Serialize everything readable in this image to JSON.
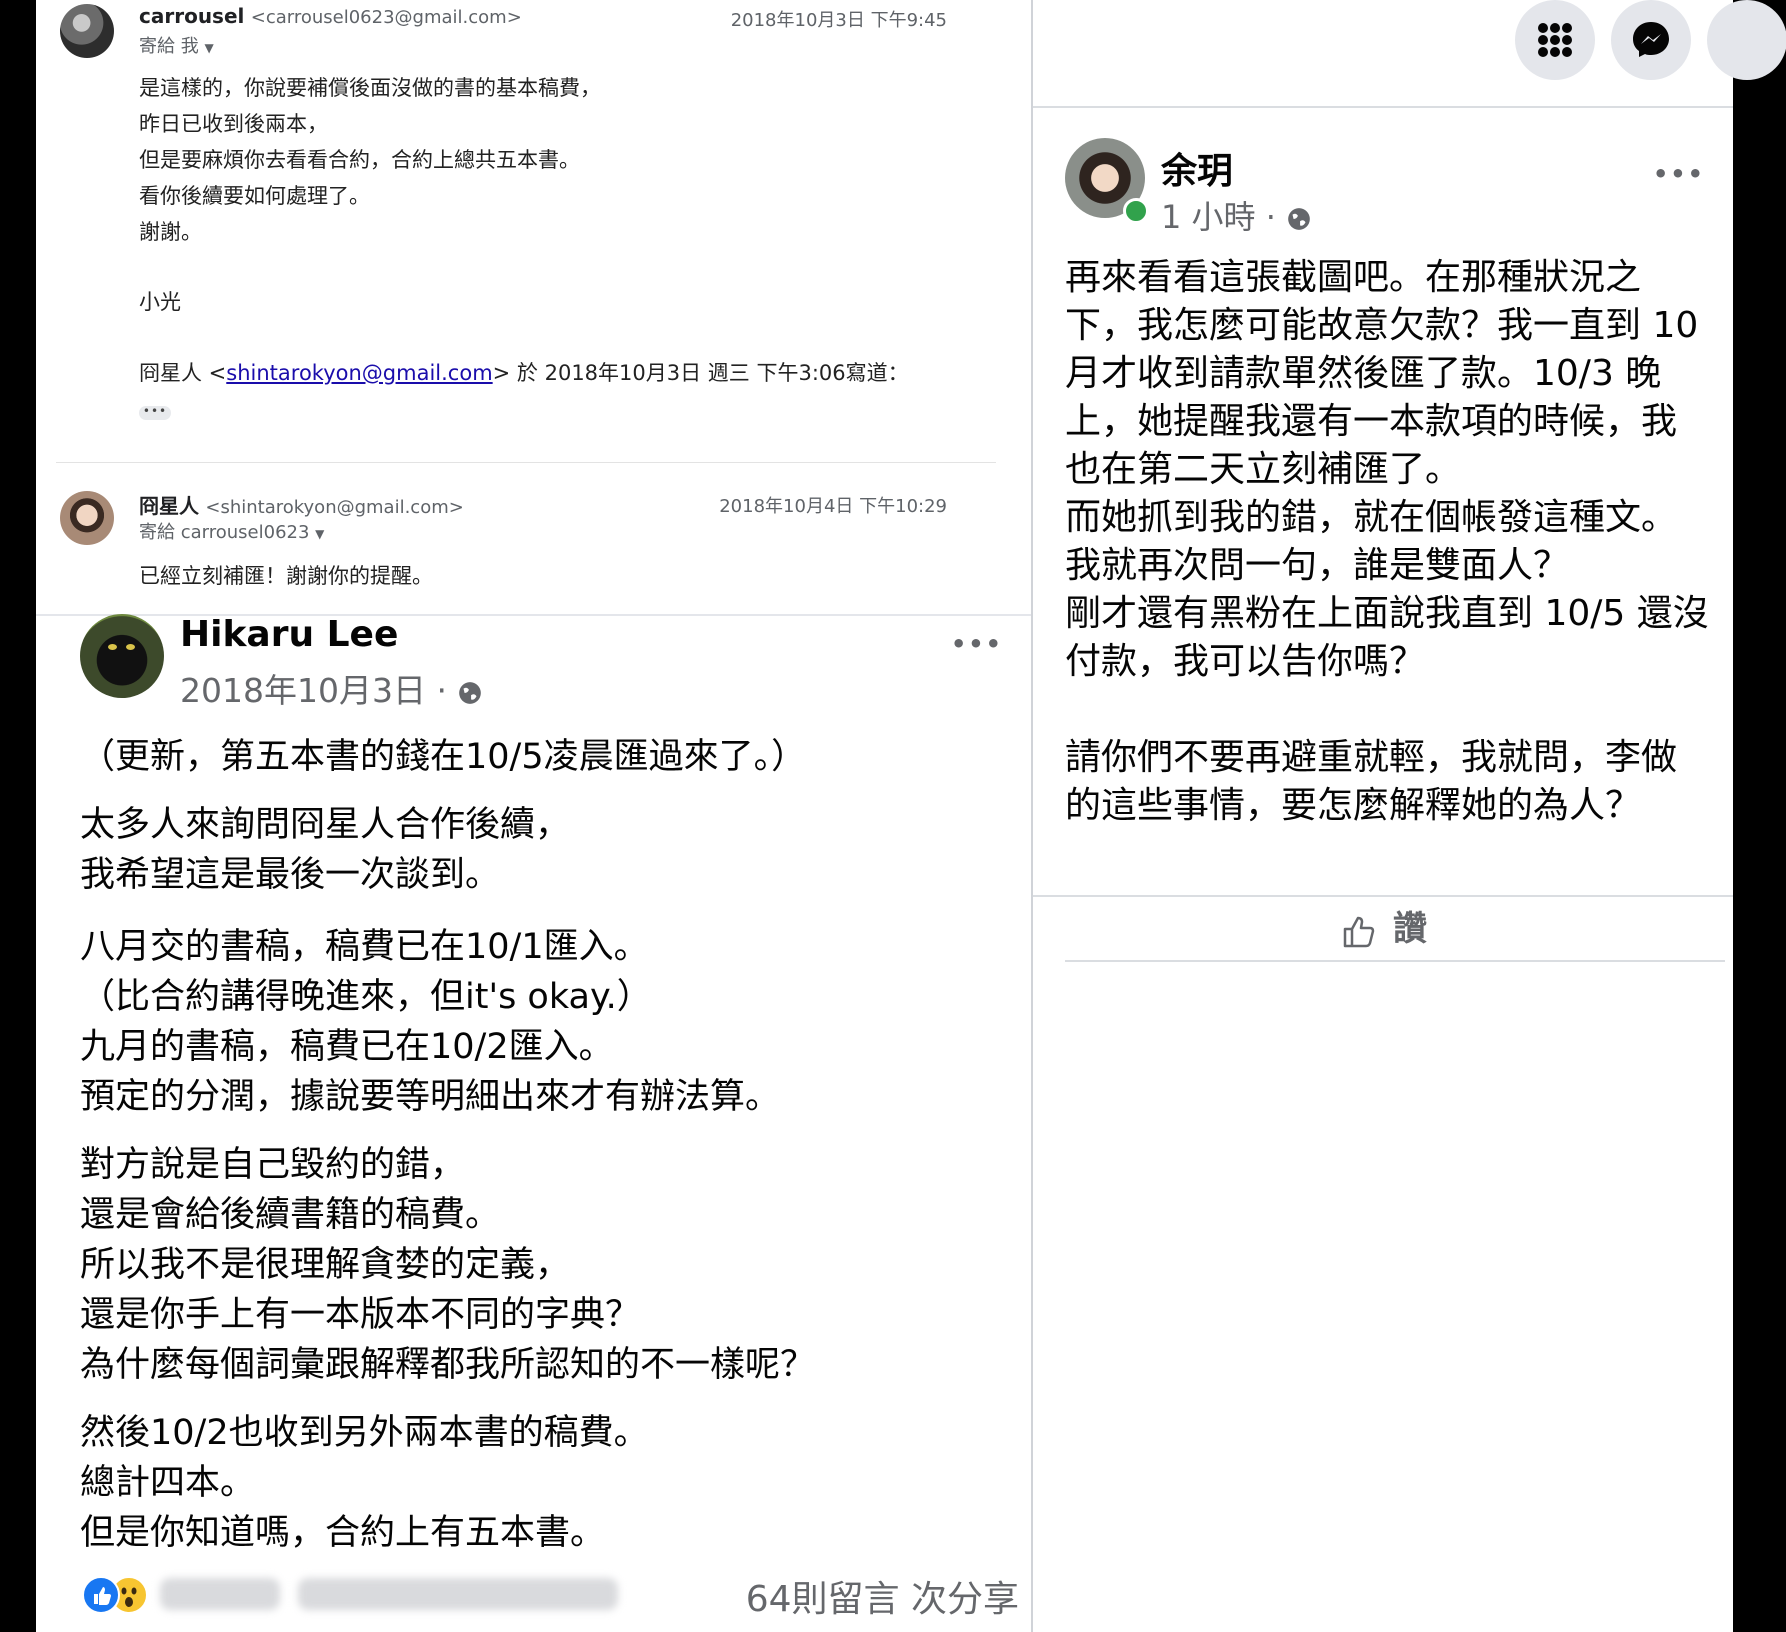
{
  "gmail": {
    "message1": {
      "sender_name": "carrousel",
      "sender_email": "<carrousel0623@gmail.com>",
      "to_line": "寄給 我",
      "date": "2018年10月3日 下午9:45",
      "body": [
        "是這樣的，你說要補償後面沒做的書的基本稿費，",
        "昨日已收到後兩本，",
        "但是要麻煩你去看看合約，合約上總共五本書。",
        "看你後續要如何處理了。",
        "謝謝。",
        "小光"
      ],
      "quote_prefix": "冏星人 <",
      "quote_link": "shintarokyon@gmail.com",
      "quote_suffix": "> 於 2018年10月3日 週三 下午3:06寫道：",
      "more_label": "•••"
    },
    "message2": {
      "sender_name": "冏星人",
      "sender_email": "<shintarokyon@gmail.com>",
      "to_line": "寄給 carrousel0623",
      "date": "2018年10月4日 下午10:29",
      "body": "已經立刻補匯！謝謝你的提醒。"
    }
  },
  "left_post": {
    "author": "Hikaru Lee",
    "time": "2018年10月3日",
    "more": "•••",
    "lines": [
      "（更新，第五本書的錢在10/5凌晨匯過來了。）",
      "太多人來詢問冏星人合作後續，",
      "我希望這是最後一次談到。",
      "八月交的書稿，稿費已在10/1匯入。",
      "（比合約講得晚進來，但it's okay.）",
      "九月的書稿，稿費已在10/2匯入。",
      "預定的分潤，據說要等明細出來才有辦法算。",
      "對方說是自己毀約的錯，",
      "還是會給後續書籍的稿費。",
      "所以我不是很理解貪婪的定義，",
      "還是你手上有一本版本不同的字典？",
      "為什麼每個詞彙跟解釋都我所認知的不一樣呢？",
      "然後10/2也收到另外兩本書的稿費。",
      "總計四本。",
      "但是你知道嗎，合約上有五本書。"
    ],
    "stats": "64則留言 次分享"
  },
  "right_post": {
    "author": "余玥",
    "time": "1 小時",
    "more": "•••",
    "lines": [
      "再來看看這張截圖吧。在那種狀況之",
      "下，我怎麼可能故意欠款？我一直到 10",
      "月才收到請款單然後匯了款。10/3 晚",
      "上，她提醒我還有一本款項的時候，我",
      "也在第二天立刻補匯了。",
      "而她抓到我的錯，就在個帳發這種文。",
      "我就再次問一句，誰是雙面人？",
      "剛才還有黑粉在上面說我直到 10/5 還沒",
      "付款，我可以告你嗎？",
      "請你們不要再避重就輕，我就問，李做",
      "的這些事情，要怎麼解釋她的為人？"
    ],
    "like_label": "讚"
  },
  "colors": {
    "fb_blue": "#1877f2",
    "link_blue": "#1a0dab",
    "meta_gray": "#65676b",
    "online_green": "#31a24c"
  }
}
